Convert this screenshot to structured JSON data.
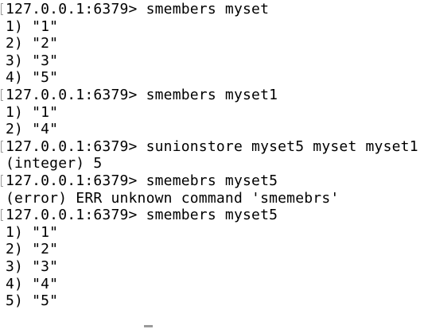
{
  "terminal": {
    "lines": [
      {
        "text": "127.0.0.1:6379> smembers myset",
        "prompt": true
      },
      {
        "text": "1) \"1\"",
        "prompt": false
      },
      {
        "text": "2) \"2\"",
        "prompt": false
      },
      {
        "text": "3) \"3\"",
        "prompt": false
      },
      {
        "text": "4) \"5\"",
        "prompt": false
      },
      {
        "text": "127.0.0.1:6379> smembers myset1",
        "prompt": true
      },
      {
        "text": "1) \"1\"",
        "prompt": false
      },
      {
        "text": "2) \"4\"",
        "prompt": false
      },
      {
        "text": "127.0.0.1:6379> sunionstore myset5 myset myset1",
        "prompt": true
      },
      {
        "text": "(integer) 5",
        "prompt": false
      },
      {
        "text": "127.0.0.1:6379> smemebrs myset5",
        "prompt": true
      },
      {
        "text": "(error) ERR unknown command 'smemebrs'",
        "prompt": false
      },
      {
        "text": "127.0.0.1:6379> smembers myset5",
        "prompt": true
      },
      {
        "text": "1) \"1\"",
        "prompt": false
      },
      {
        "text": "2) \"2\"",
        "prompt": false
      },
      {
        "text": "3) \"3\"",
        "prompt": false
      },
      {
        "text": "4) \"4\"",
        "prompt": false
      },
      {
        "text": "5) \"5\"",
        "prompt": false
      }
    ]
  }
}
